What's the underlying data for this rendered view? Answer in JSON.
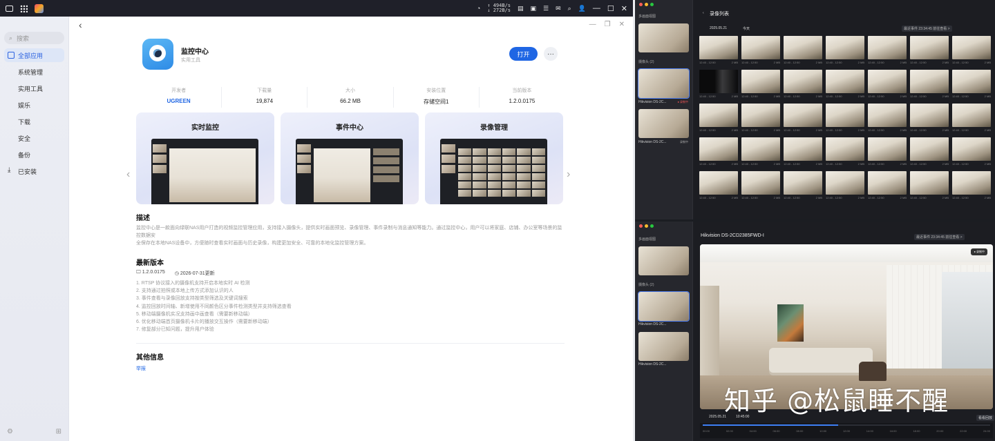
{
  "taskbar": {
    "upload_rate": "↑ 494B/s",
    "download_rate": "↓ 272B/s"
  },
  "sidebar": {
    "search_placeholder": "搜索",
    "items": [
      {
        "label": "全部应用"
      },
      {
        "label": "系统管理"
      },
      {
        "label": "实用工具"
      },
      {
        "label": "娱乐"
      },
      {
        "label": "下载"
      },
      {
        "label": "安全"
      },
      {
        "label": "备份"
      },
      {
        "label": "已安装"
      }
    ]
  },
  "app": {
    "name": "监控中心",
    "category": "实用工具",
    "open_label": "打开",
    "more_label": "···",
    "stats": [
      {
        "key": "开发者",
        "value": "UGREEN"
      },
      {
        "key": "下载量",
        "value": "19,874"
      },
      {
        "key": "大小",
        "value": "66.2 MB"
      },
      {
        "key": "安装位置",
        "value": "存储空间1"
      },
      {
        "key": "当前版本",
        "value": "1.2.0.0175"
      }
    ],
    "screenshots": [
      {
        "title": "实时监控"
      },
      {
        "title": "事件中心"
      },
      {
        "title": "录像管理"
      }
    ],
    "desc_title": "描述",
    "desc_lines": [
      "监控中心是一款面向绿联NAS用户打造的视频监控管理应用，支持接入摄像头，提供实时画面预览、录像管理、事件录制与消息通知等能力。通过监控中心，用户可以将家庭、店铺、办公室等场景的监控数据安",
      "全保存在本地NAS设备中，方便随时查看实时画面与历史录像，构建更加安全、可靠的本地化监控管理方案。"
    ],
    "latest_title": "最新版本",
    "version": "1.2.0.0175",
    "updated": "2026-07-31更新",
    "notes": [
      "1. RTSP 协议接入的摄像机支持开启本地实时 AI 检测",
      "2. 支持通过拍照或本地上传方式添加认识的人",
      "3. 事件查看与录像回放支持按类型筛选及关键词搜索",
      "4. 监控回放时间轴、新增使用不同颜色区分事件检测类型并支持筛选查看",
      "5. 移动端摄像机实况支持画中画查看（需要新移动端）",
      "6. 优化移动端首页摄像机卡片的播放交互操作（需要新移动端）",
      "7. 修复部分已知问题，提升用户体验"
    ],
    "other_title": "其他信息",
    "report_label": "举报"
  },
  "pane_top": {
    "sidebar_group": "多画面视图",
    "cameras_label": "摄像头 (2)",
    "cam_name": "Hikvision DS-2C...",
    "cam_status": "● 录制中",
    "cam_status2": "录制中",
    "title": "录像列表",
    "date": "2025.05.21",
    "today": "今天",
    "event_chip": "最近事件  23:34:45  前往查看  >",
    "cell_time": "12:40 - 12:50",
    "cell_size": "2 MB"
  },
  "pane_bottom": {
    "title": "Hikvision DS-2CD2385FWD-I",
    "event_chip": "最近事件  23:34:45  前往查看  >",
    "badge": "● 录制中",
    "date": "2025.05.21",
    "time": "10:45:00",
    "playback": "看看回放",
    "ticks": [
      "00:00",
      "02:00",
      "04:00",
      "06:00",
      "08:00",
      "10:00",
      "12:00",
      "14:00",
      "16:00",
      "18:00",
      "20:00",
      "22:00",
      "24:00"
    ],
    "progress": 0.47
  },
  "watermark": "知乎 @松鼠睡不醒",
  "colors": {
    "accent": "#1f66e4",
    "dark_bg": "#1c1d22"
  }
}
